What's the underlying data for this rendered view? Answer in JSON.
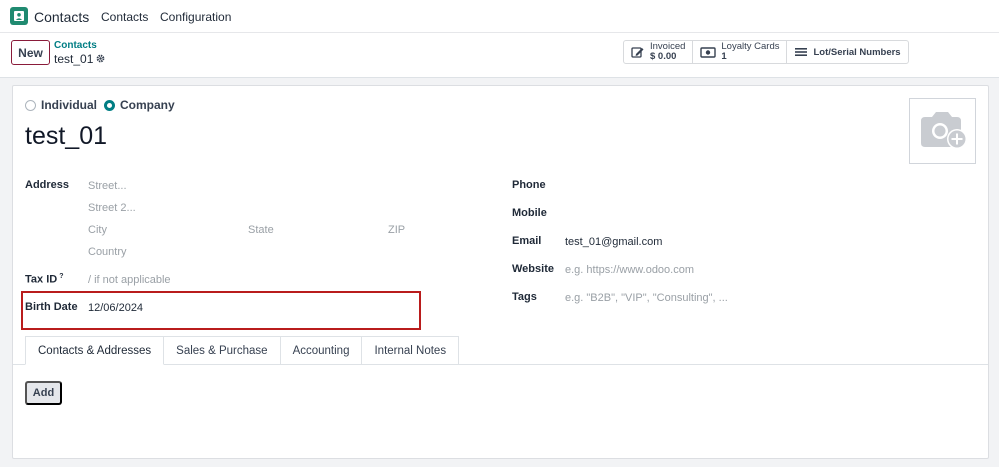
{
  "navbar": {
    "app_name": "Contacts",
    "menu": [
      "Contacts",
      "Configuration"
    ]
  },
  "control_panel": {
    "new_label": "New",
    "breadcrumb_parent": "Contacts",
    "breadcrumb_current": "test_01",
    "smart_buttons": {
      "invoiced_label": "Invoiced",
      "invoiced_value": "$ 0.00",
      "loyalty_label": "Loyalty Cards",
      "loyalty_value": "1",
      "lot_label": "Lot/Serial Numbers"
    }
  },
  "form": {
    "company_type": {
      "individual": "Individual",
      "company": "Company",
      "selected": "Company"
    },
    "name": "test_01",
    "address": {
      "label": "Address",
      "street_placeholder": "Street...",
      "street2_placeholder": "Street 2...",
      "city_placeholder": "City",
      "state_placeholder": "State",
      "zip_placeholder": "ZIP",
      "country_placeholder": "Country"
    },
    "tax_id": {
      "label": "Tax ID",
      "tooltip_mark": "?",
      "placeholder": "/ if not applicable"
    },
    "birth_date": {
      "label": "Birth Date",
      "value": "12/06/2024"
    },
    "phone": {
      "label": "Phone",
      "value": ""
    },
    "mobile": {
      "label": "Mobile",
      "value": ""
    },
    "email": {
      "label": "Email",
      "value": "test_01@gmail.com"
    },
    "website": {
      "label": "Website",
      "placeholder": "e.g. https://www.odoo.com"
    },
    "tags": {
      "label": "Tags",
      "placeholder": "e.g. \"B2B\", \"VIP\", \"Consulting\", ..."
    }
  },
  "tabs": [
    {
      "label": "Contacts & Addresses",
      "active": true
    },
    {
      "label": "Sales & Purchase",
      "active": false
    },
    {
      "label": "Accounting",
      "active": false
    },
    {
      "label": "Internal Notes",
      "active": false
    }
  ],
  "add_label": "Add",
  "icons": {
    "app": "contacts-app-icon",
    "gear": "gear-icon",
    "invoice": "pencil-square-icon",
    "loyalty": "money-bill-icon",
    "lot": "list-icon",
    "avatar": "camera-plus-icon"
  },
  "colors": {
    "accent": "#017e84",
    "highlight": "#b91c1c",
    "brand": "#1f8a70"
  }
}
